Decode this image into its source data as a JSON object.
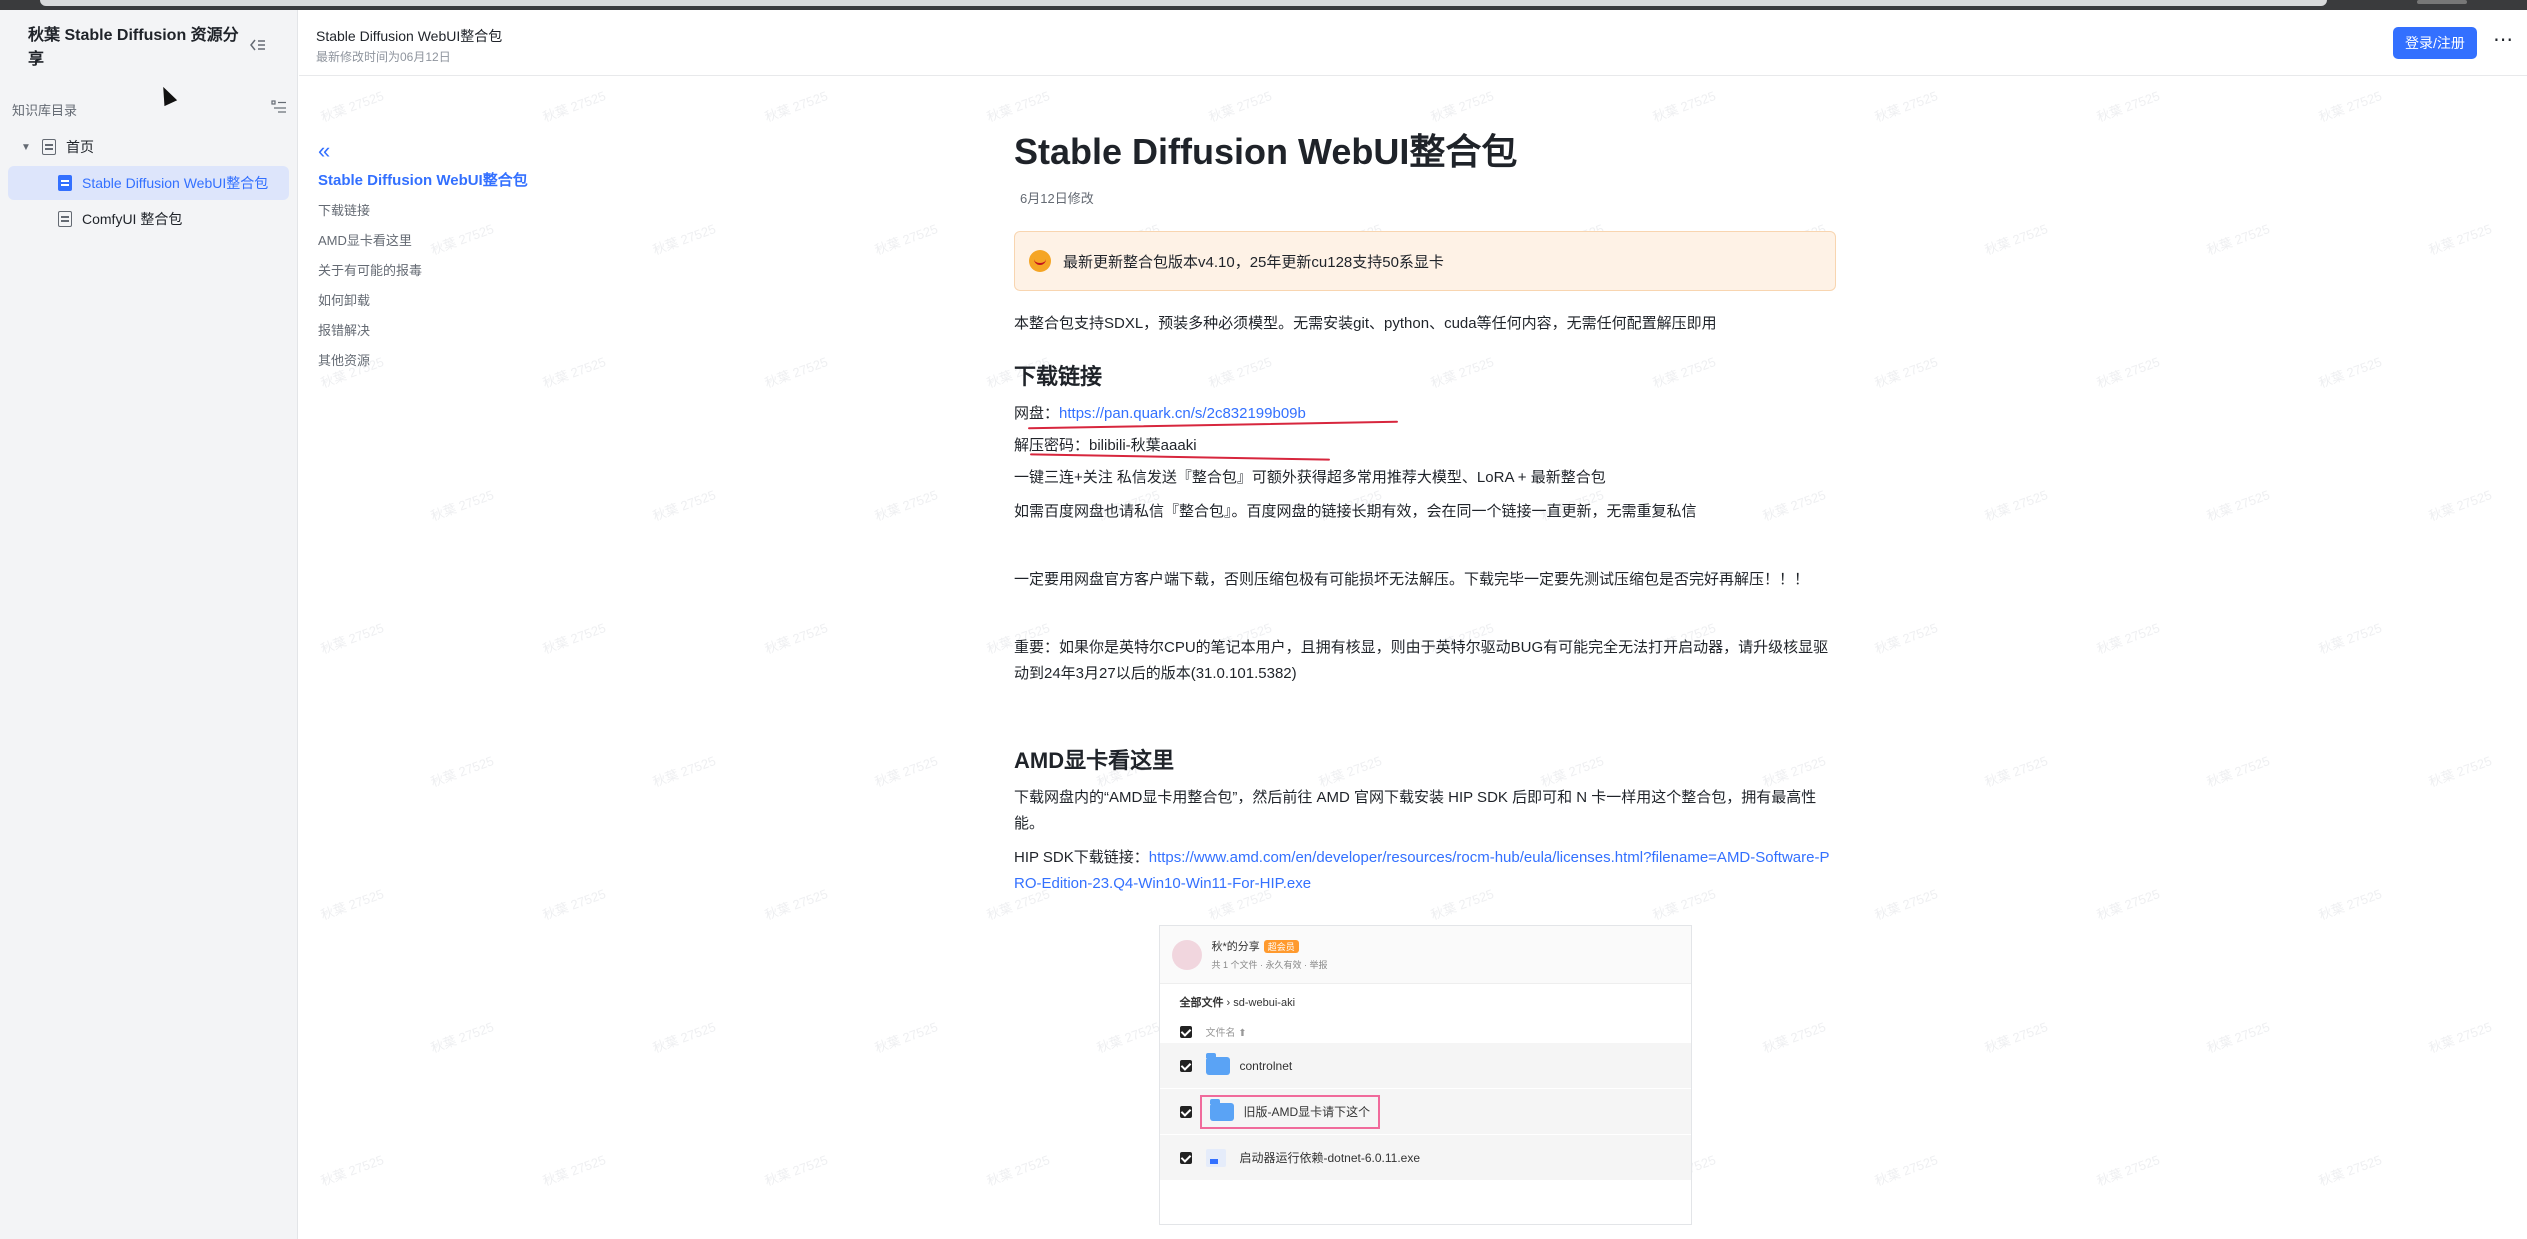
{
  "sidebar": {
    "kb_title": "秋葉 Stable Diffusion 资源分享",
    "dir_label": "知识库目录",
    "items": [
      {
        "label": "首页"
      },
      {
        "label": "Stable Diffusion WebUI整合包"
      },
      {
        "label": "ComfyUI 整合包"
      }
    ]
  },
  "header": {
    "title": "Stable Diffusion WebUI整合包",
    "subtitle": "最新修改时间为06月12日",
    "login_label": "登录/注册",
    "more_label": "⋯"
  },
  "toc": {
    "back_label": "«",
    "items": [
      {
        "label": "Stable Diffusion WebUI整合包"
      },
      {
        "label": "下载链接"
      },
      {
        "label": "AMD显卡看这里"
      },
      {
        "label": "关于有可能的报毒"
      },
      {
        "label": "如何卸载"
      },
      {
        "label": "报错解决"
      },
      {
        "label": "其他资源"
      }
    ]
  },
  "doc": {
    "title": "Stable Diffusion WebUI整合包",
    "date": "6月12日修改",
    "callout": "最新更新整合包版本v4.10，25年更新cu128支持50系显卡",
    "intro": "本整合包支持SDXL，预装多种必须模型。无需安装git、python、cuda等任何内容，无需任何配置解压即用",
    "h_download": "下载链接",
    "netdisk_label": "网盘：",
    "netdisk_url": "https://pan.quark.cn/s/2c832199b09b",
    "password": "解压密码：bilibili-秋葉aaaki",
    "p_triple": "一键三连+关注 私信发送『整合包』可额外获得超多常用推荐大模型、LoRA + 最新整合包",
    "p_baidu": "如需百度网盘也请私信『整合包』。百度网盘的链接长期有效，会在同一个链接一直更新，无需重复私信",
    "p_client": "一定要用网盘官方客户端下载，否则压缩包极有可能损坏无法解压。下载完毕一定要先测试压缩包是否完好再解压！！！",
    "p_intel": "重要：如果你是英特尔CPU的笔记本用户，且拥有核显，则由于英特尔驱动BUG有可能完全无法打开启动器，请升级核显驱动到24年3月27以后的版本(31.0.101.5382)",
    "h_amd": "AMD显卡看这里",
    "p_amd": "下载网盘内的“AMD显卡用整合包”，然后前往 AMD 官网下载安装 HIP SDK 后即可和 N 卡一样用这个整合包，拥有最高性能。",
    "hip_label": "HIP SDK下载链接：",
    "hip_url": "https://www.amd.com/en/developer/resources/rocm-hub/eula/licenses.html?filename=AMD-Software-PRO-Edition-23.Q4-Win10-Win11-For-HIP.exe"
  },
  "shot": {
    "user": "秋*的分享",
    "badge": "超会员",
    "meta": "共 1 个文件 · 永久有效 · 举报",
    "crumb_root": "全部文件",
    "crumb_sep": " › ",
    "crumb_folder": "sd-webui-aki",
    "col_header": "文件名 ⬆",
    "rows": [
      {
        "label": "controlnet"
      },
      {
        "label": "旧版-AMD显卡请下这个"
      },
      {
        "label": "启动器运行依赖-dotnet-6.0.11.exe"
      }
    ]
  },
  "watermark_text": "秋葉 27525"
}
